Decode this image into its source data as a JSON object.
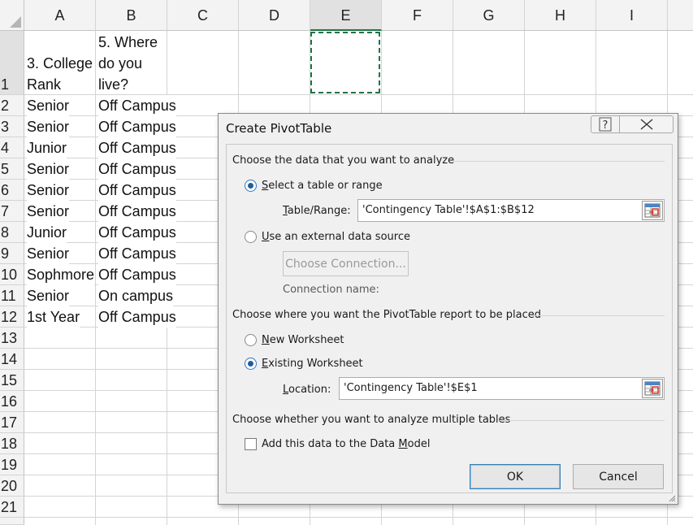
{
  "columns": [
    "A",
    "B",
    "C",
    "D",
    "E",
    "F",
    "G",
    "H",
    "I"
  ],
  "rows": [
    "1",
    "2",
    "3",
    "4",
    "5",
    "6",
    "7",
    "8",
    "9",
    "10",
    "11",
    "12",
    "13",
    "14",
    "15",
    "16",
    "17",
    "18",
    "19",
    "20",
    "21"
  ],
  "cells": {
    "A1": "3. College\nRank",
    "B1": "5. Where\ndo you\nlive?",
    "colA": [
      "Senior",
      "Senior",
      "Junior",
      "Senior",
      "Senior",
      "Senior",
      "Junior",
      "Senior",
      "Sophmore",
      "Senior",
      "1st Year"
    ],
    "colB": [
      "Off Campus",
      "Off Campus",
      "Off Campus",
      "Off Campus",
      "Off Campus",
      "Off Campus",
      "Off Campus",
      "Off Campus",
      "Off Campus",
      "On campus",
      "Off Campus"
    ]
  },
  "dialog": {
    "title": "Create PivotTable",
    "help_button": "?",
    "section1": "Choose the data that you want to analyze",
    "opt_select_table_a": "S",
    "opt_select_table_b": "elect a table or range",
    "table_range_label_a": "T",
    "table_range_label_b": "able/Range:",
    "table_range_value": "'Contingency Table'!$A$1:$B$12",
    "opt_external_a": "U",
    "opt_external_b": "se an external data source",
    "choose_connection": "Choose Connection...",
    "connection_name": "Connection name:",
    "section2": "Choose where you want the PivotTable report to be placed",
    "opt_new_ws_a": "N",
    "opt_new_ws_b": "ew Worksheet",
    "opt_existing_ws_a": "E",
    "opt_existing_ws_b": "xisting Worksheet",
    "location_label_a": "L",
    "location_label_b": "ocation:",
    "location_value": "'Contingency Table'!$E$1",
    "section3": "Choose whether you want to analyze multiple tables",
    "add_model_a": "Add this data to the Data ",
    "add_model_b": "M",
    "add_model_c": "odel",
    "ok": "OK",
    "cancel": "Cancel"
  },
  "state": {
    "select_table_selected": true,
    "external_source_selected": false,
    "new_worksheet_selected": false,
    "existing_worksheet_selected": true,
    "add_to_data_model_checked": false
  },
  "icons": {
    "help": "question-mark-icon",
    "close": "close-x-icon",
    "range_picker": "range-selector-icon"
  },
  "colors": {
    "selection_marquee": "#217346",
    "radio_dot": "#1f5e9e",
    "header_bg": "#f3f3f3"
  }
}
